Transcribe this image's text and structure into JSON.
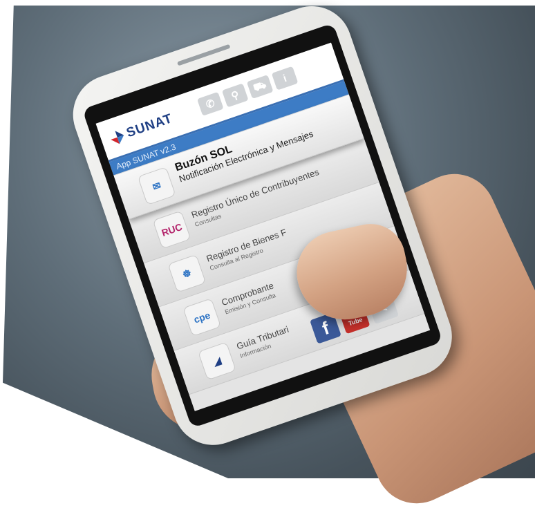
{
  "app": {
    "logo": "SUNAT",
    "version": "App SUNAT v2.3"
  },
  "header_icons": [
    {
      "name": "phone-icon",
      "glyph": "✆"
    },
    {
      "name": "location-icon",
      "glyph": "⚲"
    },
    {
      "name": "car-icon",
      "glyph": "⛟"
    },
    {
      "name": "info-icon",
      "glyph": "i"
    }
  ],
  "menu": [
    {
      "title": "Buzón SOL",
      "subtitle": "Notificación Electrónica y Mensajes",
      "icon": "mailbox-icon",
      "glyph": "✉",
      "color": "#2d73c4"
    },
    {
      "title": "Registro Único de Contribuyentes",
      "subtitle": "Consultas",
      "icon": "ruc-icon",
      "glyph": "RUC",
      "color": "#b3246b"
    },
    {
      "title": "Registro de Bienes F",
      "subtitle": "Consulta al Registro",
      "icon": "goods-registry-icon",
      "glyph": "☸",
      "color": "#2d73c4"
    },
    {
      "title": "Comprobante",
      "subtitle": "Emisión y Consulta",
      "icon": "cpe-icon",
      "glyph": "cpe",
      "color": "#2d73c4"
    },
    {
      "title": "Guía Tributari",
      "subtitle": "Información",
      "icon": "guide-icon",
      "glyph": "◢",
      "color": "#1f3f84"
    }
  ],
  "social": [
    {
      "name": "facebook-button",
      "label": "f"
    },
    {
      "name": "youtube-button",
      "label": "You Tube"
    },
    {
      "name": "share-button",
      "label": "<"
    }
  ],
  "colors": {
    "brand_blue": "#3d7cc5",
    "brand_dark": "#1f3f84",
    "brand_red": "#d1262c"
  }
}
